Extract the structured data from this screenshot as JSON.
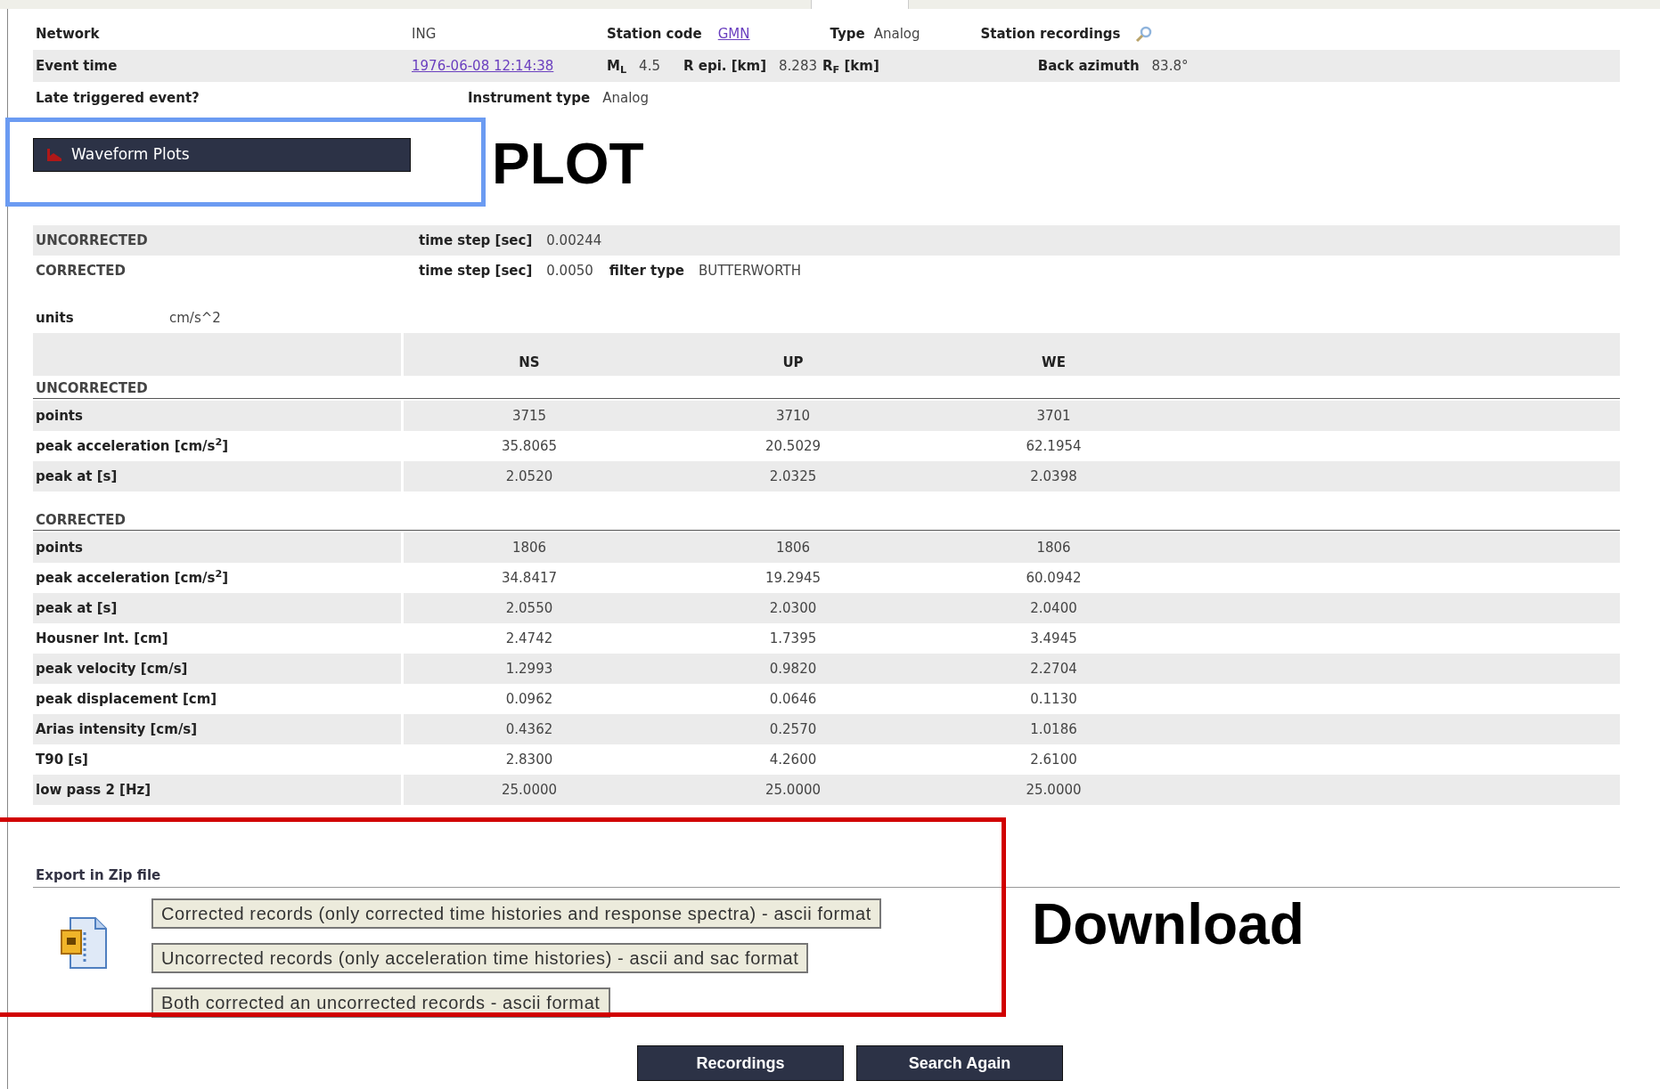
{
  "header": {
    "network_label": "Network",
    "network": "ING",
    "station_code_label": "Station code",
    "station_code": "GMN",
    "type_label": "Type",
    "type": "Analog",
    "station_recordings_label": "Station recordings",
    "event_time_label": "Event time",
    "event_time": "1976-06-08 12:14:38",
    "ml_label": "M$_{L}$",
    "ml": "4.5",
    "repi_label": "R epi. [km]",
    "repi": "8.283",
    "rf_label": "R$_{F}$ [km]",
    "back_azimuth_label": "Back azimuth",
    "back_azimuth": "83.8°",
    "late_label": "Late triggered event?",
    "instrument_type_label": "Instrument type",
    "instrument_type": "Analog"
  },
  "waveform_button": "Waveform Plots",
  "plot_annotation": {
    "label": "PLOT",
    "color": "#6b9bf2"
  },
  "processing": [
    {
      "name": "UNCORRECTED",
      "time_step_label": "time step [sec]",
      "time_step": "0.00244"
    },
    {
      "name": "CORRECTED",
      "time_step_label": "time step [sec]",
      "time_step": "0.0050",
      "filter_label": "filter type",
      "filter": "BUTTERWORTH"
    }
  ],
  "units": {
    "label": "units",
    "value": "cm/s^2"
  },
  "table": {
    "columns": [
      "NS",
      "UP",
      "WE"
    ],
    "sections": [
      {
        "title": "UNCORRECTED",
        "rows": [
          {
            "label": "points",
            "values": [
              "3715",
              "3710",
              "3701"
            ]
          },
          {
            "label": "peak acceleration [cm/s$^{2}$]",
            "values": [
              "35.8065",
              "20.5029",
              "62.1954"
            ]
          },
          {
            "label": "peak at [s]",
            "values": [
              "2.0520",
              "2.0325",
              "2.0398"
            ]
          }
        ]
      },
      {
        "title": "CORRECTED",
        "rows": [
          {
            "label": "points",
            "values": [
              "1806",
              "1806",
              "1806"
            ]
          },
          {
            "label": "peak acceleration [cm/s$^{2}$]",
            "values": [
              "34.8417",
              "19.2945",
              "60.0942"
            ]
          },
          {
            "label": "peak at [s]",
            "values": [
              "2.0550",
              "2.0300",
              "2.0400"
            ]
          },
          {
            "label": "Housner Int. [cm]",
            "values": [
              "2.4742",
              "1.7395",
              "3.4945"
            ]
          },
          {
            "label": "peak velocity [cm/s]",
            "values": [
              "1.2993",
              "0.9820",
              "2.2704"
            ]
          },
          {
            "label": "peak displacement [cm]",
            "values": [
              "0.0962",
              "0.0646",
              "0.1130"
            ]
          },
          {
            "label": "Arias intensity [cm/s]",
            "values": [
              "0.4362",
              "0.2570",
              "1.0186"
            ]
          },
          {
            "label": "T90 [s]",
            "values": [
              "2.8300",
              "4.2600",
              "2.6100"
            ]
          },
          {
            "label": "low pass 2 [Hz]",
            "values": [
              "25.0000",
              "25.0000",
              "25.0000"
            ]
          }
        ]
      }
    ]
  },
  "export": {
    "title": "Export in Zip file",
    "downloads": [
      "Corrected records (only corrected time histories and response spectra) - ascii format",
      "Uncorrected records (only acceleration time histories) - ascii and sac format",
      "Both corrected an uncorrected records - ascii format"
    ]
  },
  "download_annotation": {
    "label": "Download",
    "color": "#d10000"
  },
  "buttons": [
    "Recordings",
    "Search Again"
  ]
}
